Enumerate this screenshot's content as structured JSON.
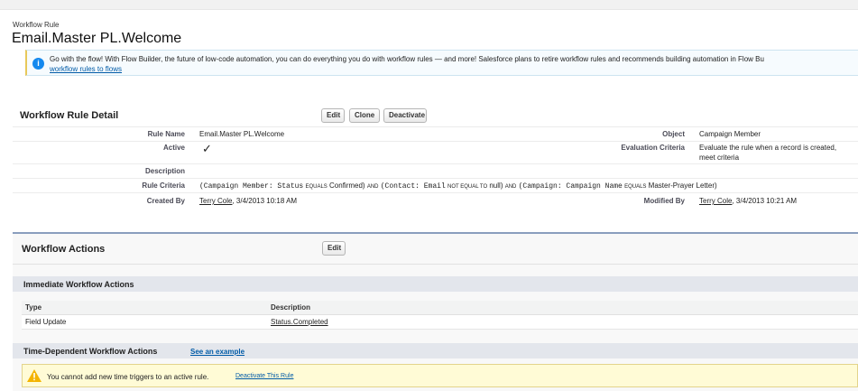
{
  "page": {
    "object_type": "Workflow Rule",
    "title": "Email.Master PL.Welcome"
  },
  "banner": {
    "message": "Go with the flow! With Flow Builder, the future of low-code automation, you can do everything you do with workflow rules — and more! Salesforce plans to retire workflow rules and recommends building automation in Flow Bu",
    "link": "workflow rules to flows"
  },
  "detail": {
    "title": "Workflow Rule Detail",
    "buttons": {
      "edit": "Edit",
      "clone": "Clone",
      "deactivate": "Deactivate"
    },
    "labels": {
      "rule_name": "Rule Name",
      "active": "Active",
      "description": "Description",
      "rule_criteria": "Rule Criteria",
      "created_by": "Created By",
      "object": "Object",
      "evaluation_criteria": "Evaluation Criteria",
      "modified_by": "Modified By"
    },
    "values": {
      "rule_name": "Email.Master PL.Welcome",
      "active_check": "✓",
      "description": "",
      "object": "Campaign Member",
      "evaluation_line1": "Evaluate the rule when a record is created,",
      "evaluation_line2": "meet criteria",
      "created_by_name": "Terry Cole",
      "created_by_date": ", 3/4/2013 10:18 AM",
      "modified_by_name": "Terry Cole",
      "modified_by_date": ", 3/4/2013 10:21 AM"
    },
    "criteria": {
      "field1": "(Campaign Member: Status",
      "op1": "EQUALS",
      "val1": "Confirmed)",
      "and1": "AND",
      "field2": "(Contact: Email",
      "op2": "NOT EQUAL TO",
      "val2": "null)",
      "and2": "AND",
      "field3": "(Campaign: Campaign Name",
      "op3": "EQUALS",
      "val3": "Master-Prayer Letter)"
    }
  },
  "actions": {
    "title": "Workflow Actions",
    "edit": "Edit",
    "immediate_title": "Immediate Workflow Actions",
    "columns": [
      "Type",
      "Description"
    ],
    "rows": [
      {
        "type": "Field Update",
        "description": "Status.Completed"
      }
    ],
    "time_dependent_title": "Time-Dependent Workflow Actions",
    "see_example": "See an example",
    "warning": "You cannot add new time triggers to an active rule.",
    "deactivate_link": "Deactivate This Rule"
  }
}
